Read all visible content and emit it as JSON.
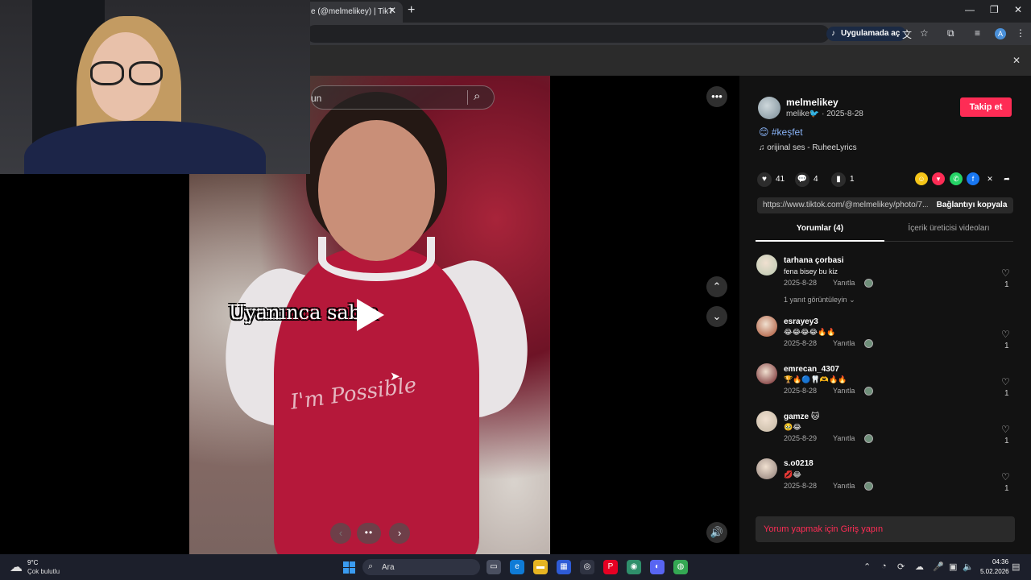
{
  "browser": {
    "tab_title": "e (@melmelikey) | TikT",
    "open_in_app": "Uygulamada aç",
    "profile_initial": "A"
  },
  "photo": {
    "search_placeholder": "un",
    "overlay_text": "Uyanınca sab   a",
    "shirt_print": "I'm Possible"
  },
  "post": {
    "username": "melmelikey",
    "display_name": "melike",
    "date": "2025-8-28",
    "follow_label": "Takip et",
    "hashtag": "#keşfet",
    "music": "orijinal ses - RuheeLyrics",
    "likes": "41",
    "comments": "4",
    "saves": "1",
    "link": "https://www.tiktok.com/@melmelikey/photo/7...",
    "copy_link_label": "Bağlantıyı kopyala"
  },
  "tabs": {
    "comments": "Yorumlar (4)",
    "creator_videos": "İçerik üreticisi videoları"
  },
  "comments": [
    {
      "user": "tarhana çorbasi",
      "text": "fena bisey bu kiz",
      "date": "2025-8-28",
      "reply": "Yanıtla",
      "likes": "1",
      "avatar_color": "#b9c9b0"
    },
    {
      "user": "esrayey3",
      "text": "😂😂😂😂🔥🔥",
      "date": "2025-8-28",
      "reply": "Yanıtla",
      "likes": "1",
      "avatar_color": "#a84d2e"
    },
    {
      "user": "emrecan_4307",
      "text": "🏆🔥🔵🦷🫶🔥🔥",
      "date": "2025-8-28",
      "reply": "Yanıtla",
      "likes": "1",
      "avatar_color": "#6b1c22"
    },
    {
      "user": "gamze 🐱",
      "text": "🥹😂",
      "date": "2025-8-29",
      "reply": "Yanıtla",
      "likes": "1",
      "avatar_color": "#c4b7a3"
    },
    {
      "user": "s.o0218",
      "text": "💋😂",
      "date": "2025-8-28",
      "reply": "Yanıtla",
      "likes": "1",
      "avatar_color": "#8b7a74"
    }
  ],
  "view_replies": "1 yanıt görüntüleyin",
  "login_prompt": "Yorum yapmak için Giriş yapın",
  "taskbar": {
    "weather_temp": "9°C",
    "weather_desc": "Çok bulutlu",
    "search_label": "Ara",
    "time": "04:36",
    "date": "5.02.2026"
  }
}
